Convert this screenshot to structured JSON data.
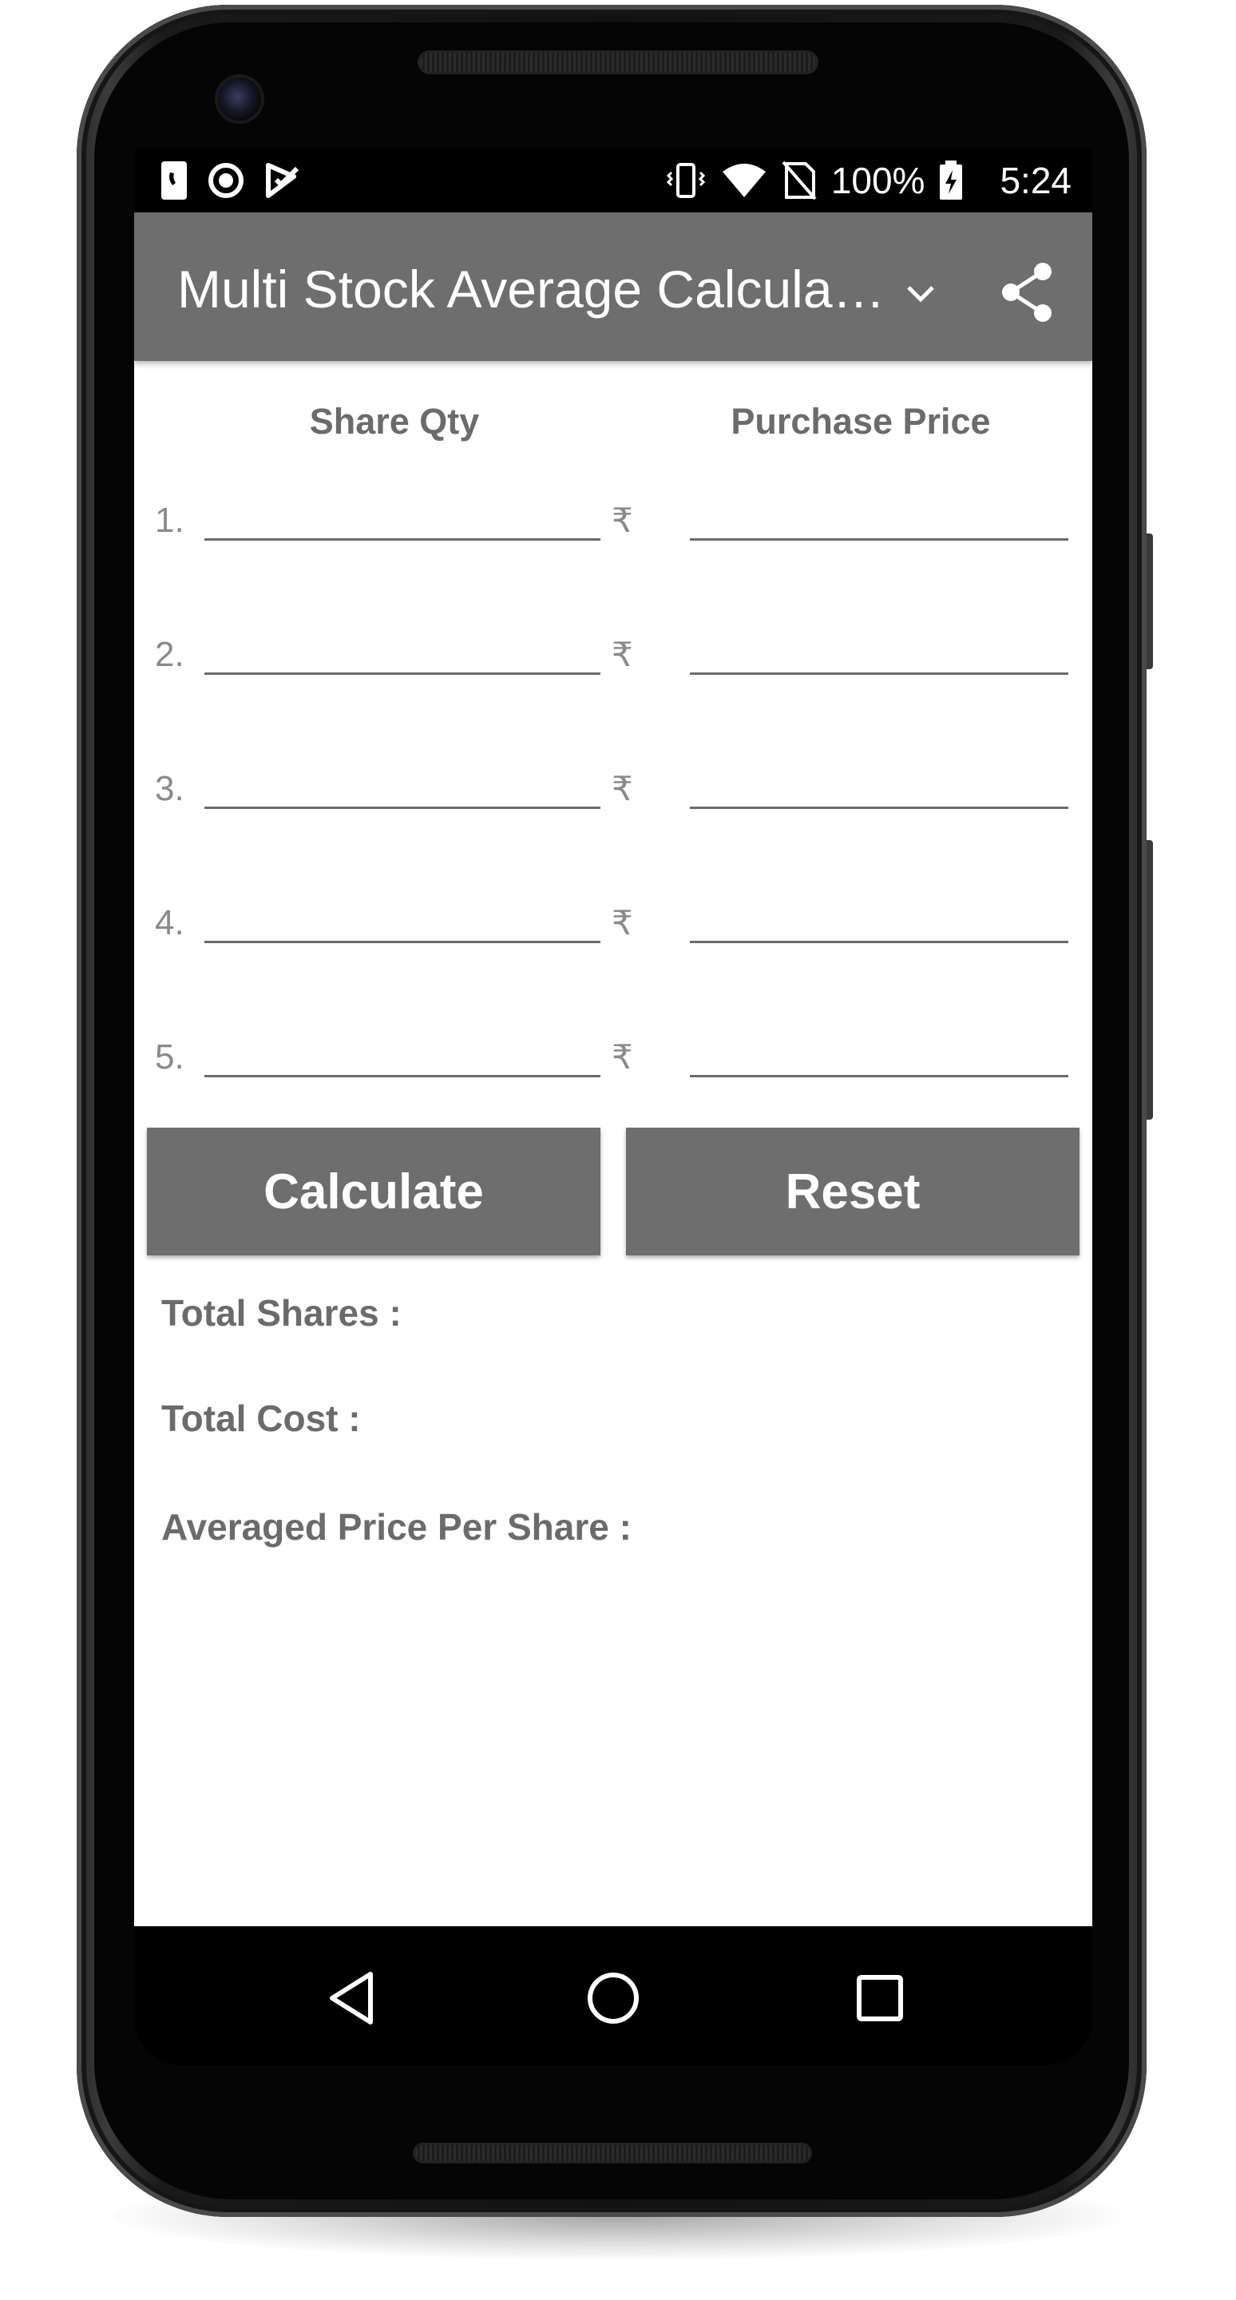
{
  "status_bar": {
    "battery": "100%",
    "time": "5:24"
  },
  "app_bar": {
    "title": "Multi Stock Average Calcula…"
  },
  "form": {
    "headers": {
      "qty": "Share Qty",
      "price": "Purchase Price"
    },
    "currency": "₹",
    "rows": [
      {
        "label": "1.",
        "qty": "",
        "price": ""
      },
      {
        "label": "2.",
        "qty": "",
        "price": ""
      },
      {
        "label": "3.",
        "qty": "",
        "price": ""
      },
      {
        "label": "4.",
        "qty": "",
        "price": ""
      },
      {
        "label": "5.",
        "qty": "",
        "price": ""
      }
    ]
  },
  "buttons": {
    "calculate": "Calculate",
    "reset": "Reset"
  },
  "results": {
    "total_shares": "Total Shares :",
    "total_cost": "Total Cost :",
    "average_price": "Averaged Price Per Share :"
  },
  "colors": {
    "primary": "#6e6e6e",
    "label": "#6b6b6b",
    "muted": "#8a8a8a",
    "background": "#ffffff"
  }
}
